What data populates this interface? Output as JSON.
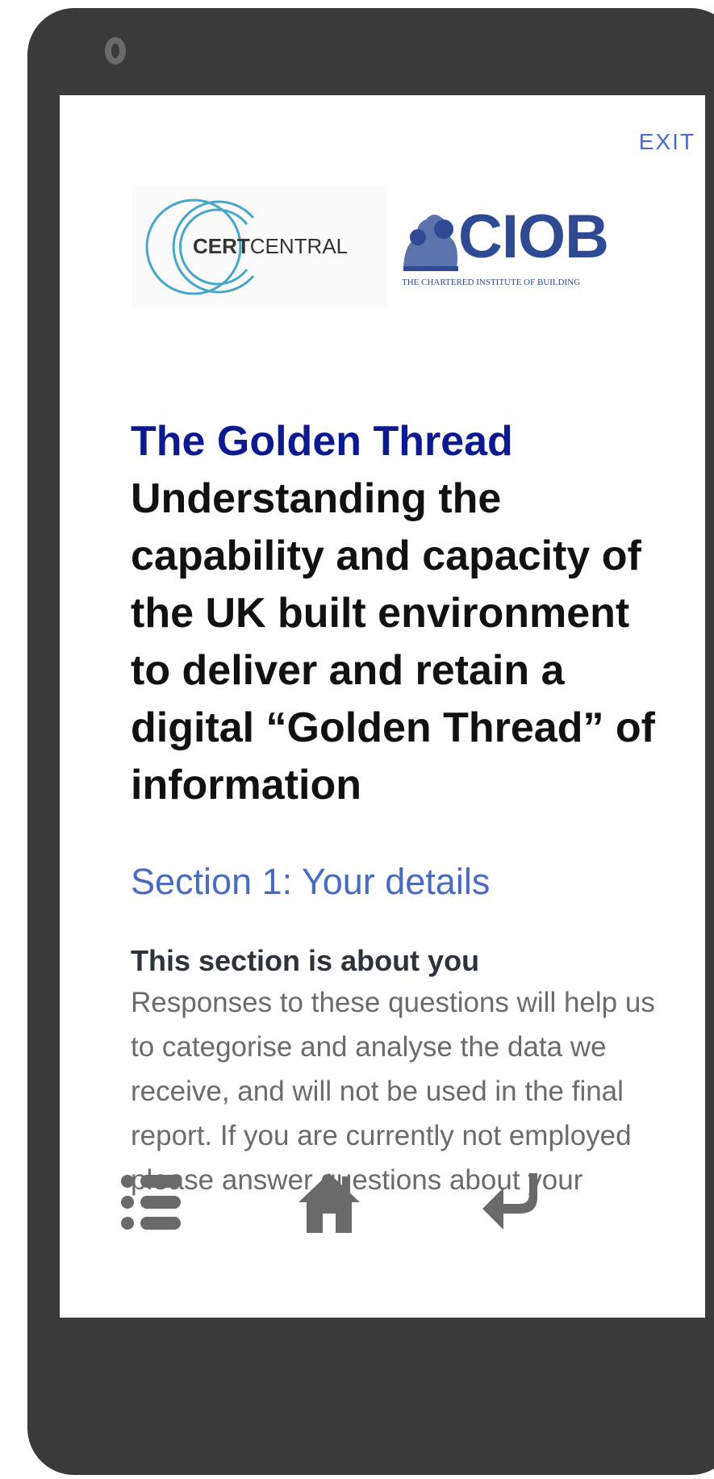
{
  "header": {
    "exit_label": "EXIT"
  },
  "logos": {
    "certcentral": {
      "bold": "CERT",
      "regular": "CENTRAL"
    },
    "ciob": {
      "name": "CIOB",
      "tagline": "THE CHARTERED INSTITUTE OF BUILDING"
    }
  },
  "intro": {
    "title": "The Golden Thread",
    "subtitle": "Understanding the capability and capacity of the UK built environment to deliver and retain a digital “Golden Thread” of information"
  },
  "section": {
    "heading": "Section 1: Your details",
    "about_title": "This section is about you",
    "description": "Responses to these questions will help us to categorise and analyse the data we receive, and will not be used in the final report. If you are currently not employed please answer questions about your"
  },
  "nav": {
    "icons": [
      "list-icon",
      "home-icon",
      "back-arrow-icon"
    ]
  },
  "colors": {
    "frame": "#3a3a3a",
    "accent": "#4a6bbf",
    "title_navy": "#0b1a8f",
    "icon_gray": "#6a6a6a"
  }
}
